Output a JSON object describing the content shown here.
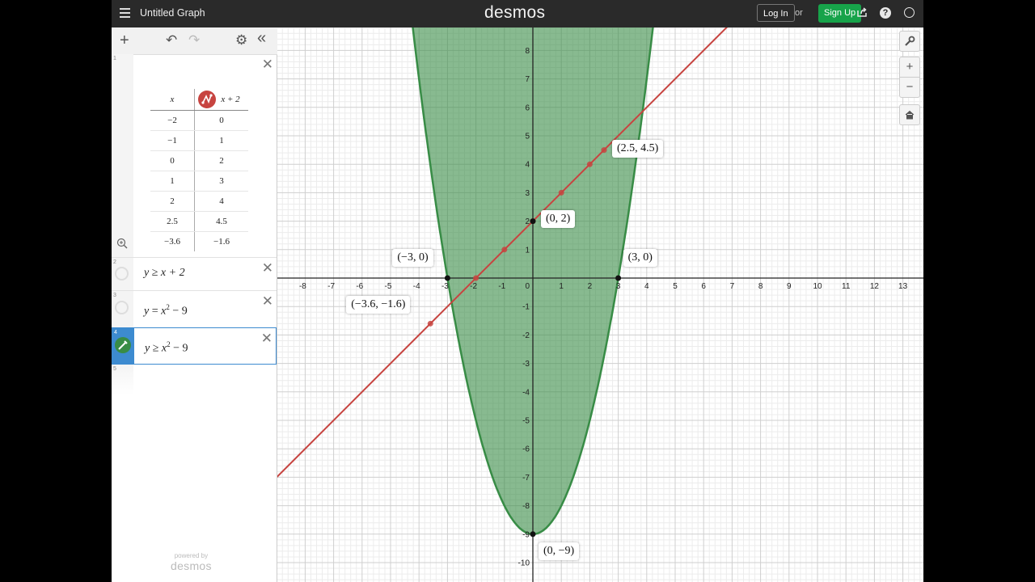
{
  "header": {
    "title": "Untitled Graph",
    "logo": "desmos",
    "login_label": "Log In",
    "or_label": "or",
    "signup_label": "Sign Up",
    "icons": [
      "menu-icon",
      "share-icon",
      "help-icon",
      "globe-icon"
    ]
  },
  "toolbar": {
    "add": "+",
    "undo": "↶",
    "redo": "↷",
    "settings": "⚙",
    "collapse": "«"
  },
  "expressions": [
    {
      "index": "1",
      "type": "table",
      "columns": [
        "x",
        "x + 2"
      ],
      "rows": [
        [
          "−2",
          "0"
        ],
        [
          "−1",
          "1"
        ],
        [
          "0",
          "2"
        ],
        [
          "1",
          "3"
        ],
        [
          "2",
          "4"
        ],
        [
          "2.5",
          "4.5"
        ],
        [
          "−3.6",
          "−1.6"
        ]
      ],
      "color": "#c74440"
    },
    {
      "index": "2",
      "lhs": "y",
      "op": "≥",
      "rhs": "x + 2",
      "sup": "",
      "tail": ""
    },
    {
      "index": "3",
      "lhs": "y",
      "op": "=",
      "rhs": "x",
      "sup": "2",
      "tail": " − 9"
    },
    {
      "index": "4",
      "lhs": "y",
      "op": "≥",
      "rhs": "x",
      "sup": "2",
      "tail": " − 9",
      "color": "#388c46"
    },
    {
      "index": "5"
    }
  ],
  "powered_by": {
    "small": "powered by",
    "logo": "desmos"
  },
  "graph_controls": {
    "wrench": "wrench-icon",
    "zoom_in": "+",
    "zoom_out": "−",
    "home": "home-icon"
  },
  "chart_data": {
    "type": "scatter",
    "x_ticks": [
      "-8",
      "-7",
      "-6",
      "-5",
      "-4",
      "-3",
      "-2",
      "-1",
      "0",
      "1",
      "2",
      "3",
      "4",
      "5",
      "6",
      "7",
      "8",
      "9",
      "10",
      "11",
      "12",
      "13"
    ],
    "y_ticks": [
      "8",
      "7",
      "6",
      "5",
      "4",
      "3",
      "2",
      "1",
      "-1",
      "-2",
      "-3",
      "-4",
      "-5",
      "-6",
      "-7",
      "-8",
      "-9",
      "-10"
    ],
    "xlim": [
      -8.9,
      13.7
    ],
    "ylim": [
      -10.6,
      8.9
    ],
    "grid": true,
    "series": [
      {
        "expr": "y = x + 2",
        "color": "#c74440",
        "kind": "line"
      },
      {
        "expr": "y ≥ x^2 − 9",
        "color": "#388c46",
        "kind": "shaded"
      },
      {
        "kind": "points",
        "color": "#c74440",
        "points": [
          [
            -2,
            0
          ],
          [
            -1,
            1
          ],
          [
            0,
            2
          ],
          [
            1,
            3
          ],
          [
            2,
            4
          ],
          [
            2.5,
            4.5
          ],
          [
            -3.6,
            -1.6
          ]
        ]
      }
    ],
    "annotations": [
      {
        "label": "(0, 2)",
        "x": 0,
        "y": 2
      },
      {
        "label": "(−3, 0)",
        "x": -3,
        "y": 0
      },
      {
        "label": "(3, 0)",
        "x": 3,
        "y": 0
      },
      {
        "label": "(2.5, 4.5)",
        "x": 2.5,
        "y": 4.5
      },
      {
        "label": "(−3.6, −1.6)",
        "x": -3.6,
        "y": -1.6
      },
      {
        "label": "(0, −9)",
        "x": 0,
        "y": -9
      }
    ]
  }
}
